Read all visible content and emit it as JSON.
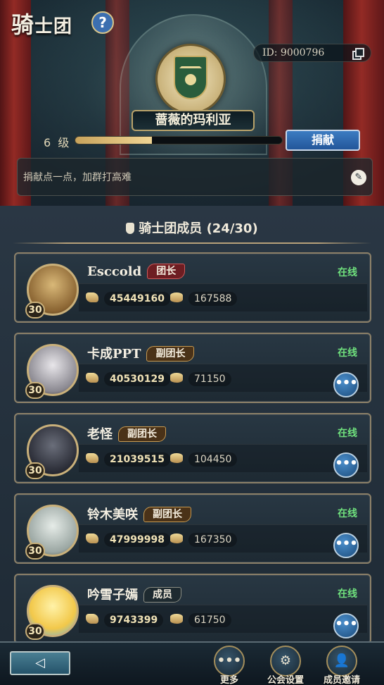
{
  "header": {
    "title_big": "骑",
    "title_rest": "士团",
    "help_label": "?",
    "guild_id": "ID: 9000796",
    "guild_name": "蔷薇的玛利亚",
    "level_number": "6",
    "level_unit": "级",
    "level_progress": 0.37,
    "donate_label": "捐献",
    "motto": "捐献点一点，加群打高难"
  },
  "members_section": {
    "title": "骑士团成员 (24/30)",
    "members": [
      {
        "name": "Esccold",
        "role": "团长",
        "role_type": "leader",
        "status": "在线",
        "level": "30",
        "stat1": "45449160",
        "stat2": "167588",
        "has_more": false
      },
      {
        "name": "卡成PPT",
        "role": "副团长",
        "role_type": "vice",
        "status": "在线",
        "level": "30",
        "stat1": "40530129",
        "stat2": "71150",
        "has_more": true
      },
      {
        "name": "老怪",
        "role": "副团长",
        "role_type": "vice",
        "status": "在线",
        "level": "30",
        "stat1": "21039515",
        "stat2": "104450",
        "has_more": true
      },
      {
        "name": "铃木美咲",
        "role": "副团长",
        "role_type": "vice",
        "status": "在线",
        "level": "30",
        "stat1": "47999998",
        "stat2": "167350",
        "has_more": true
      },
      {
        "name": "吟雪子嫣",
        "role": "成员",
        "role_type": "member",
        "status": "在线",
        "level": "30",
        "stat1": "9743399",
        "stat2": "61750",
        "has_more": true
      }
    ]
  },
  "bottom_bar": {
    "back_label": "◁",
    "more_label": "更多",
    "settings_label": "公会设置",
    "invite_label": "成员邀请"
  },
  "colors": {
    "online": "#6fe07d",
    "accent_blue": "#3d7cc2",
    "gold": "#c9b07a"
  }
}
